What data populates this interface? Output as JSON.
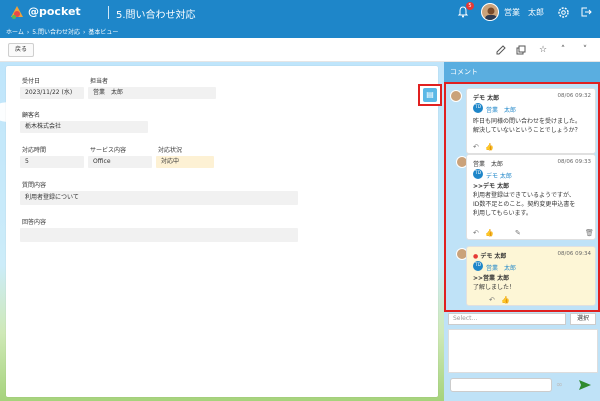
{
  "header": {
    "brand": "@pocket",
    "title": "5.問い合わせ対応",
    "notifications_count": "5",
    "user_name": "営業　太郎"
  },
  "breadcrumb": [
    "ホーム",
    "5.問い合わせ対応",
    "基本ビュー"
  ],
  "toolbar": {
    "back_label": "戻る"
  },
  "form": {
    "received_date_label": "受付日",
    "received_date_value": "2023/11/22 (水)",
    "assignee_label": "担当者",
    "assignee_value": "営業　太郎",
    "customer_label": "顧客名",
    "customer_value": "栃木株式会社",
    "response_time_label": "対応時間",
    "response_time_value": "5",
    "service_label": "サービス内容",
    "service_value": "Office",
    "status_label": "対応状況",
    "status_value": "対応中",
    "question_label": "質問内容",
    "question_value": "利用者登録について",
    "answer_label": "回答内容",
    "answer_value": ""
  },
  "comments": {
    "header": "コメント",
    "items": [
      {
        "author": "デモ 太郎",
        "time": "08/06 09:32",
        "mention_badge": "TD",
        "mention": "営業　太郎",
        "text_lines": [
          "昨日も同様の問い合わせを受けました。",
          "解決していないということでしょうか？"
        ]
      },
      {
        "author": "営業　太郎",
        "time": "08/06 09:33",
        "mention_badge": "TD",
        "mention": "デモ 太郎",
        "quote": ">>デモ 太郎",
        "text_lines": [
          "利用者登録はできているようですが、",
          "ID数不足とのこと。契約変更申込書を",
          "利用してもらいます。"
        ]
      },
      {
        "author": "デモ 太郎",
        "time": "08/06 09:34",
        "mention_badge": "TD",
        "mention": "営業　太郎",
        "quote": ">>営業 太郎",
        "text_lines": [
          "了解しました！"
        ]
      }
    ],
    "select_placeholder": "Select...",
    "select_button": "選択"
  }
}
